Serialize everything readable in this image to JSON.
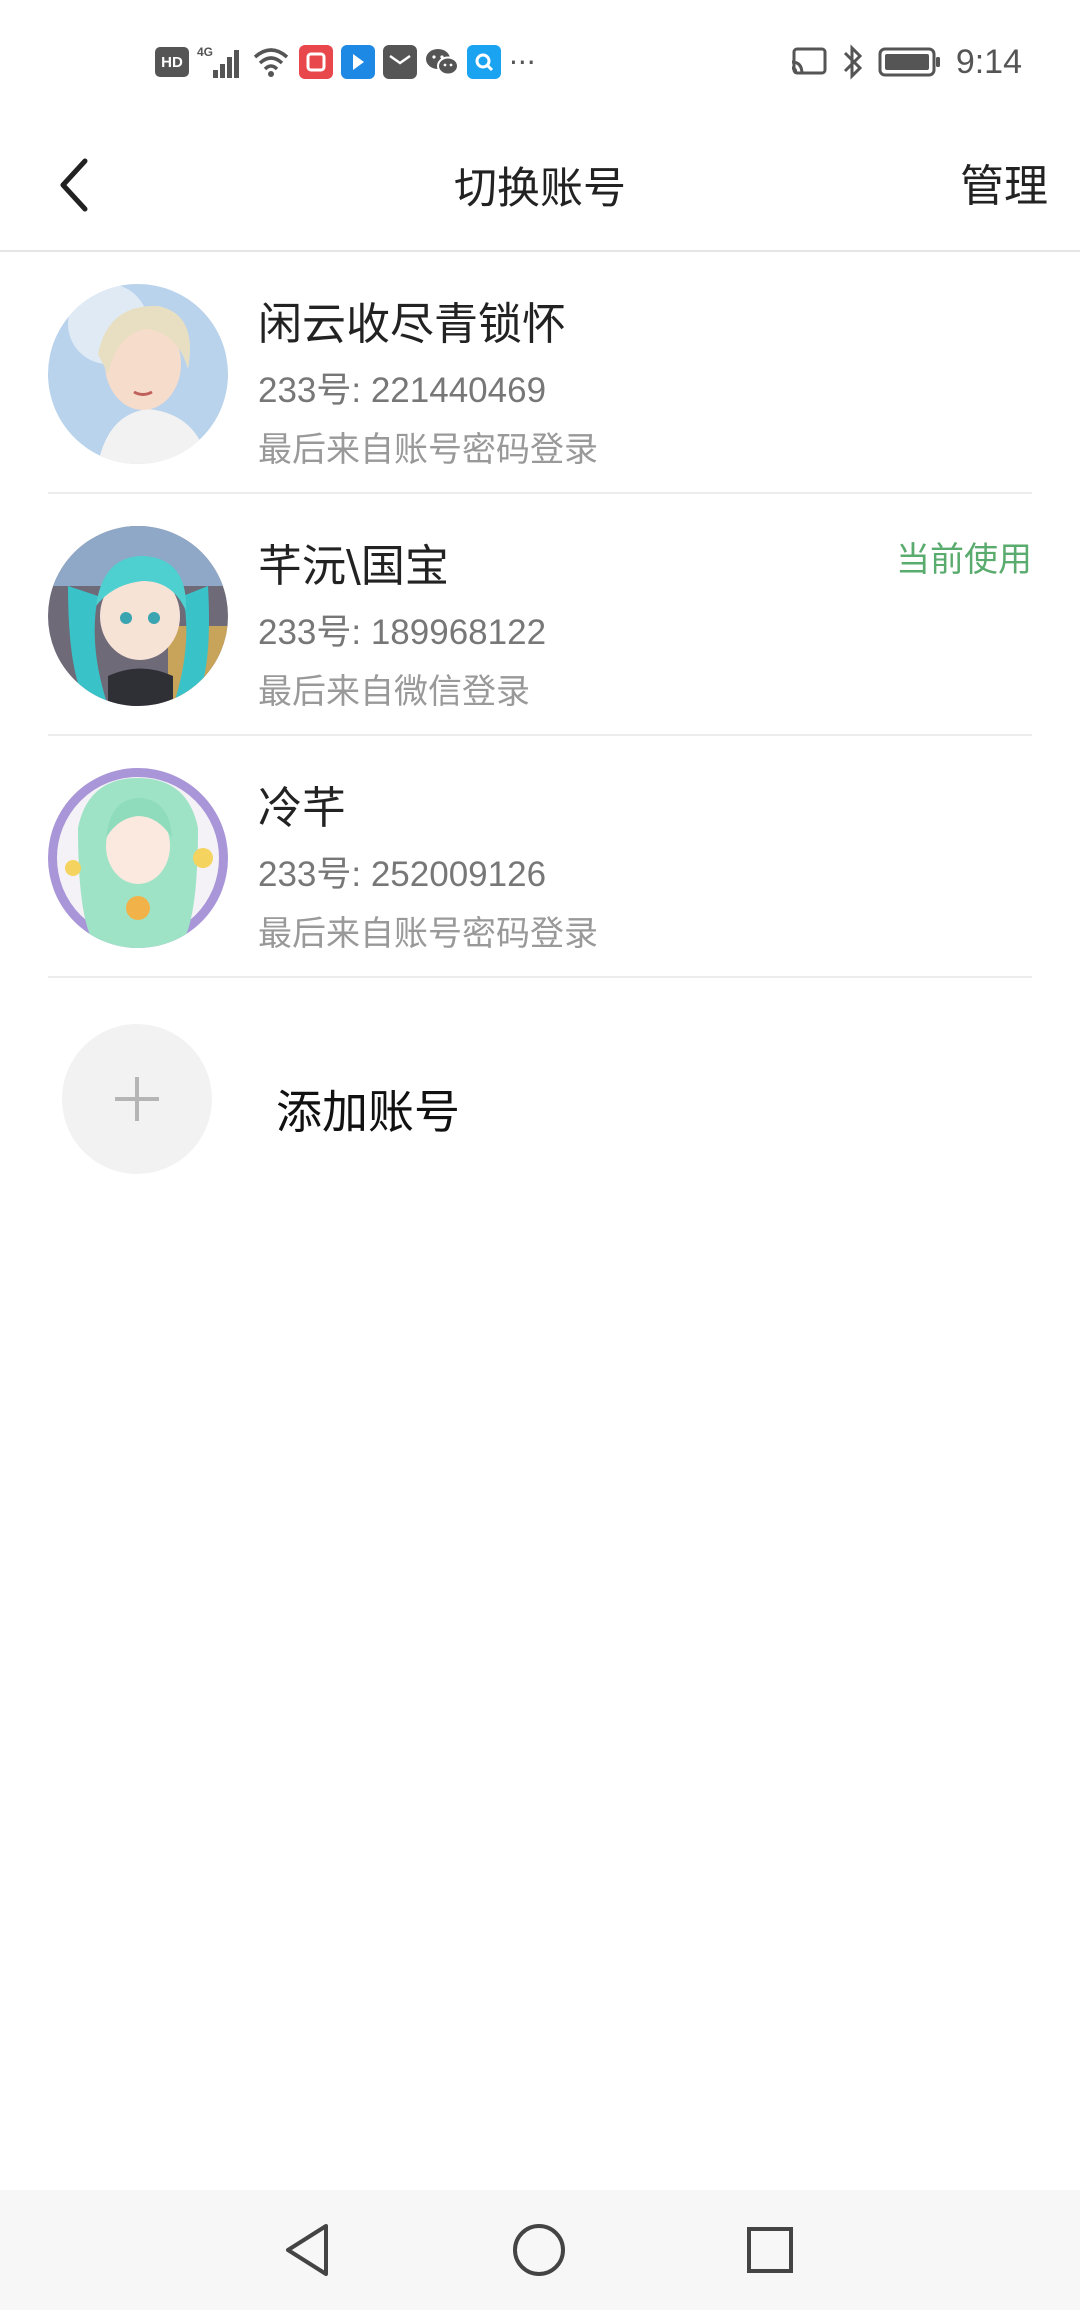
{
  "status_bar": {
    "hd_label": "HD",
    "network_label": "4G",
    "time": "9:14",
    "more_label": "···",
    "icons": [
      "hd-icon",
      "signal-icon",
      "wifi-icon",
      "app-notification-icon",
      "bilibili-icon",
      "mail-icon",
      "wechat-icon",
      "qq-search-icon",
      "more-icon",
      "cast-icon",
      "bluetooth-icon",
      "battery-icon"
    ]
  },
  "header": {
    "title": "切换账号",
    "manage_label": "管理"
  },
  "accounts": [
    {
      "name": "闲云收尽青锁怀",
      "id_text": "233号: 221440469",
      "login_text": "最后来自账号密码登录",
      "current": false
    },
    {
      "name": "芊沅\\国宝",
      "id_text": "233号: 189968122",
      "login_text": "最后来自微信登录",
      "current": true,
      "current_label": "当前使用"
    },
    {
      "name": "冷芊",
      "id_text": "233号: 252009126",
      "login_text": "最后来自账号密码登录",
      "current": false
    }
  ],
  "add_account": {
    "label": "添加账号"
  },
  "colors": {
    "accent_green": "#5aab6e",
    "divider": "#ececec"
  },
  "nav_bar": {
    "icons": [
      "nav-back-icon",
      "nav-home-icon",
      "nav-recents-icon"
    ]
  }
}
